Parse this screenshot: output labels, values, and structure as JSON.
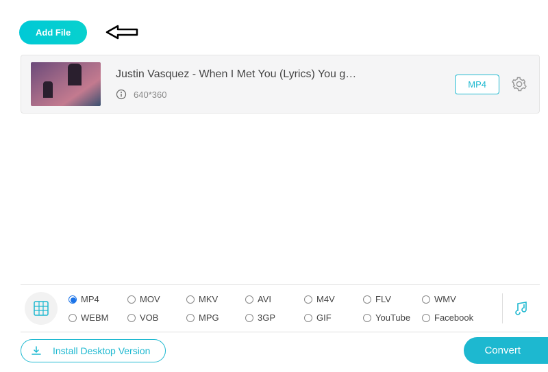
{
  "add_file_label": "Add File",
  "file": {
    "title": "Justin Vasquez - When I Met You (Lyrics) You g…",
    "resolution": "640*360",
    "output_format": "MP4"
  },
  "formats": {
    "row1": [
      {
        "label": "MP4",
        "selected": true
      },
      {
        "label": "MOV",
        "selected": false
      },
      {
        "label": "MKV",
        "selected": false
      },
      {
        "label": "AVI",
        "selected": false
      },
      {
        "label": "M4V",
        "selected": false
      },
      {
        "label": "FLV",
        "selected": false
      },
      {
        "label": "WMV",
        "selected": false
      }
    ],
    "row2": [
      {
        "label": "WEBM",
        "selected": false
      },
      {
        "label": "VOB",
        "selected": false
      },
      {
        "label": "MPG",
        "selected": false
      },
      {
        "label": "3GP",
        "selected": false
      },
      {
        "label": "GIF",
        "selected": false
      },
      {
        "label": "YouTube",
        "selected": false
      },
      {
        "label": "Facebook",
        "selected": false
      }
    ]
  },
  "install_label": "Install Desktop Version",
  "convert_label": "Convert"
}
